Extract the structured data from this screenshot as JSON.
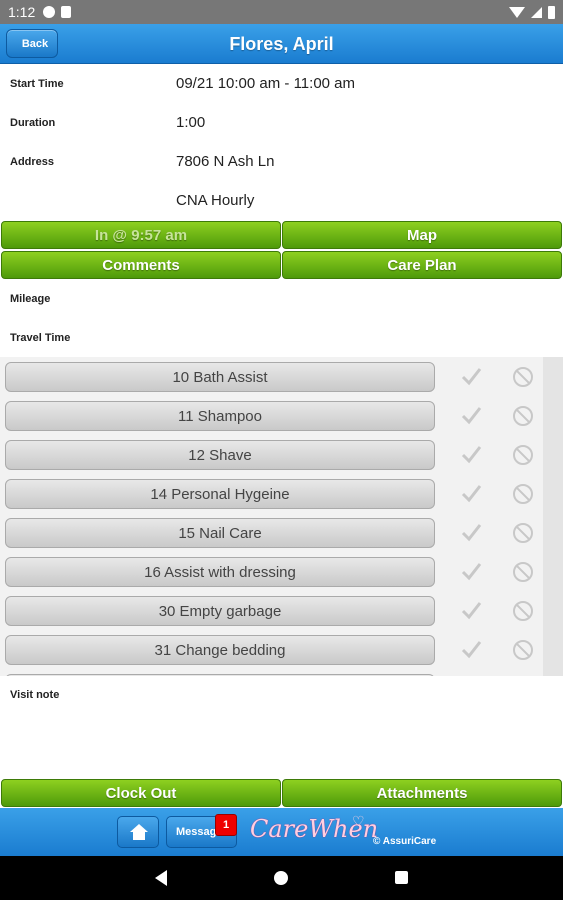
{
  "status_bar": {
    "time": "1:12"
  },
  "header": {
    "back_label": "Back",
    "title": "Flores, April"
  },
  "visit": {
    "start_time_label": "Start Time",
    "start_time_value": "09/21 10:00 am - 11:00 am",
    "duration_label": "Duration",
    "duration_value": "1:00",
    "address_label": "Address",
    "address_value": "7806 N Ash Ln",
    "service_value": "CNA Hourly"
  },
  "actions": {
    "clock_in_label": "In @ 9:57 am",
    "map_label": "Map",
    "comments_label": "Comments",
    "care_plan_label": "Care Plan"
  },
  "fields": {
    "mileage_label": "Mileage",
    "travel_time_label": "Travel Time",
    "visit_note_label": "Visit note"
  },
  "tasks": [
    {
      "label": "10 Bath Assist"
    },
    {
      "label": "11 Shampoo"
    },
    {
      "label": "12 Shave"
    },
    {
      "label": "14 Personal Hygeine"
    },
    {
      "label": "15 Nail Care"
    },
    {
      "label": "16 Assist with dressing"
    },
    {
      "label": "30 Empty garbage"
    },
    {
      "label": "31 Change bedding"
    }
  ],
  "bottom_actions": {
    "clock_out_label": "Clock Out",
    "attachments_label": "Attachments"
  },
  "footer": {
    "messages_label": "Messag...",
    "messages_badge": "1",
    "logo_text": "CareWhen",
    "copyright": "© AssuriCare"
  },
  "colors": {
    "header_blue": "#1a7cd0",
    "button_green": "#5aa812",
    "badge_red": "#e00000"
  }
}
